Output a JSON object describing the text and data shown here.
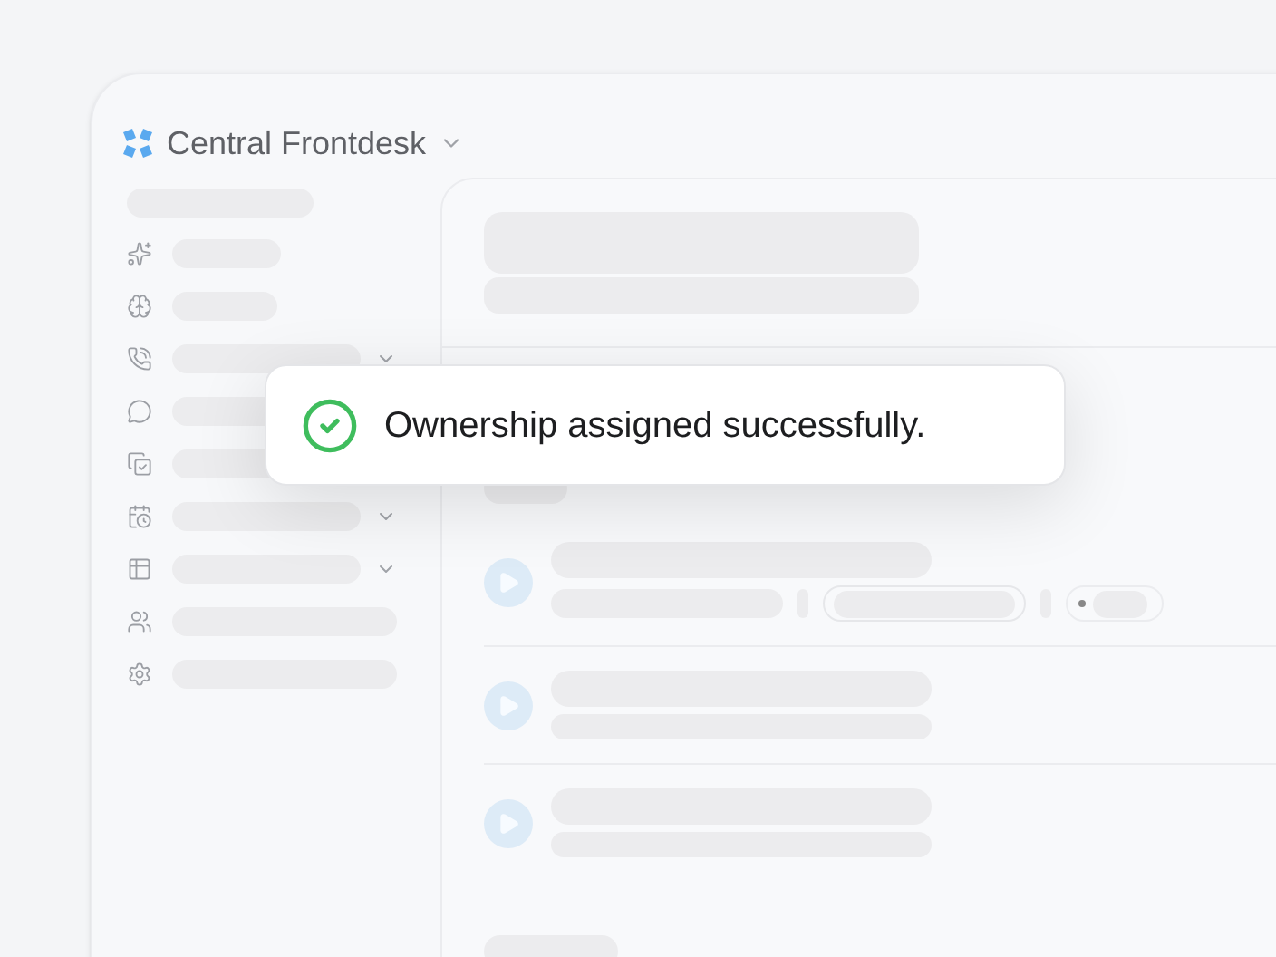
{
  "app": {
    "title": "Central Frontdesk"
  },
  "sidebar": {
    "items": [
      {
        "expandable": false
      },
      {
        "expandable": false
      },
      {
        "expandable": true
      },
      {
        "expandable": false
      },
      {
        "expandable": false
      },
      {
        "expandable": true
      },
      {
        "expandable": true
      },
      {
        "expandable": false
      },
      {
        "expandable": false
      }
    ]
  },
  "calls": [
    {
      "detailed": true
    },
    {
      "detailed": false
    },
    {
      "detailed": false
    }
  ],
  "toast": {
    "message": "Ownership assigned successfully."
  }
}
